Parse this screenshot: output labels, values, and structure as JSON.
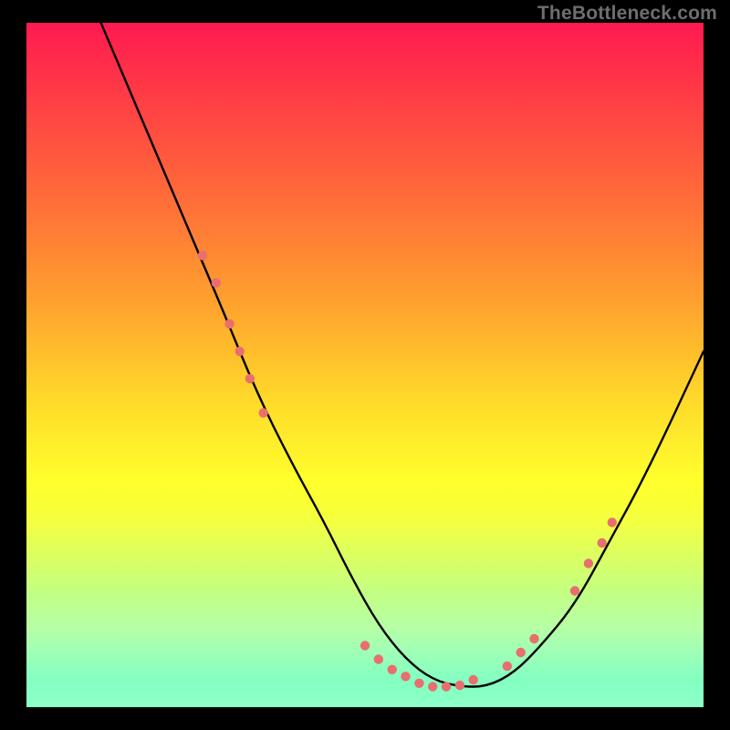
{
  "watermark": "TheBottleneck.com",
  "colors": {
    "gradient_top": "#ff1a50",
    "gradient_bottom": "#19ff8e",
    "curve_stroke": "#000000",
    "marker_fill": "#e86f6e",
    "background": "#000000"
  },
  "chart_data": {
    "type": "line",
    "title": "",
    "xlabel": "",
    "ylabel": "",
    "xlim": [
      0,
      100
    ],
    "ylim": [
      0,
      100
    ],
    "grid": false,
    "note": "No tick labels or axis numbers are shown; x/y represent approximate percent distances across the plot area.",
    "series": [
      {
        "name": "curve",
        "x": [
          11,
          17,
          23,
          29,
          34,
          39,
          44,
          48,
          52,
          56,
          60,
          64,
          68,
          72,
          76,
          81,
          86,
          92,
          100
        ],
        "y": [
          100,
          86,
          72,
          58,
          46,
          36,
          27,
          19,
          12,
          7,
          4,
          3,
          3,
          5,
          9,
          15,
          24,
          35,
          52
        ]
      }
    ],
    "markers": [
      {
        "x": 26,
        "y": 66
      },
      {
        "x": 28,
        "y": 62
      },
      {
        "x": 30,
        "y": 56
      },
      {
        "x": 31.5,
        "y": 52
      },
      {
        "x": 33,
        "y": 48
      },
      {
        "x": 35,
        "y": 43
      },
      {
        "x": 50,
        "y": 9
      },
      {
        "x": 52,
        "y": 7
      },
      {
        "x": 54,
        "y": 5.5
      },
      {
        "x": 56,
        "y": 4.5
      },
      {
        "x": 58,
        "y": 3.5
      },
      {
        "x": 60,
        "y": 3
      },
      {
        "x": 62,
        "y": 3
      },
      {
        "x": 64,
        "y": 3.2
      },
      {
        "x": 66,
        "y": 4
      },
      {
        "x": 71,
        "y": 6
      },
      {
        "x": 73,
        "y": 8
      },
      {
        "x": 75,
        "y": 10
      },
      {
        "x": 81,
        "y": 17
      },
      {
        "x": 83,
        "y": 21
      },
      {
        "x": 85,
        "y": 24
      },
      {
        "x": 86.5,
        "y": 27
      }
    ]
  }
}
